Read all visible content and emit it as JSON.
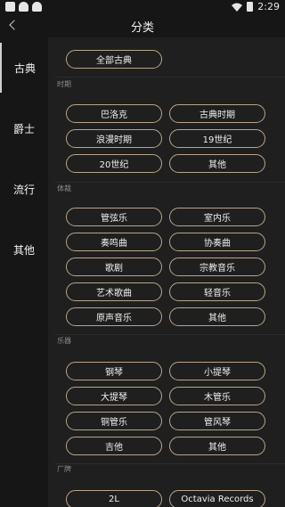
{
  "status": {
    "time": "2:29"
  },
  "header": {
    "title": "分类"
  },
  "sidebar": {
    "items": [
      "古典",
      "爵士",
      "流行",
      "其他"
    ]
  },
  "main": {
    "all_button": "全部古典",
    "sections": [
      {
        "label": "时期",
        "tags": [
          "巴洛克",
          "古典时期",
          "浪漫时期",
          "19世纪",
          "20世纪",
          "其他"
        ]
      },
      {
        "label": "体裁",
        "tags": [
          "管弦乐",
          "室内乐",
          "奏鸣曲",
          "协奏曲",
          "歌剧",
          "宗教音乐",
          "艺术歌曲",
          "轻音乐",
          "原声音乐",
          "其他"
        ]
      },
      {
        "label": "乐器",
        "tags": [
          "钢琴",
          "小提琴",
          "大提琴",
          "木管乐",
          "铜管乐",
          "管风琴",
          "吉他",
          "其他"
        ]
      },
      {
        "label": "厂牌",
        "tags": [
          "2L",
          "Octavia Records"
        ]
      }
    ]
  }
}
